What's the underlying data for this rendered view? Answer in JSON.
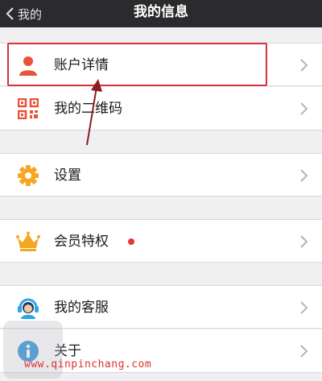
{
  "nav": {
    "back_label": "我的",
    "title": "我的信息"
  },
  "rows": [
    {
      "label": "账户详情",
      "icon": "user-icon",
      "color": "#e8533a"
    },
    {
      "label": "我的二维码",
      "icon": "qr-code-icon",
      "color": "#e8533a"
    },
    {
      "label": "设置",
      "icon": "gear-icon",
      "color": "#f5a623"
    },
    {
      "label": "会员特权",
      "icon": "crown-icon",
      "color": "#f5a623",
      "badge": "red-dot"
    },
    {
      "label": "我的客服",
      "icon": "customer-service-icon",
      "color": "#2ba5e8"
    },
    {
      "label": "关于",
      "icon": "info-icon",
      "color": "#2a8fd9"
    }
  ],
  "annotation": {
    "highlight_color": "#d6323c"
  },
  "watermark": "www.qinpinchang.com"
}
